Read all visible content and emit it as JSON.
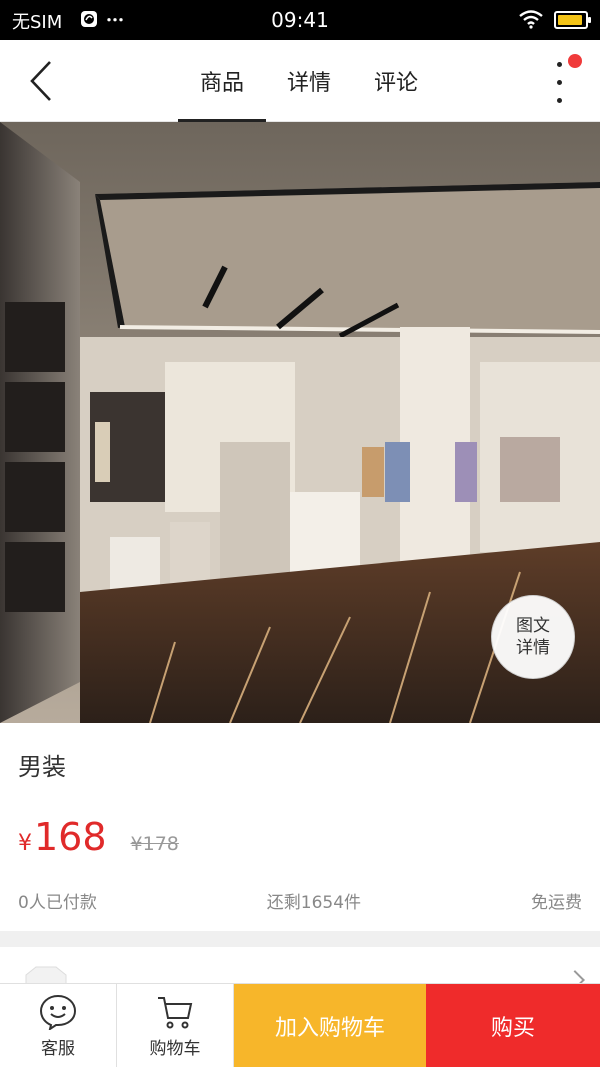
{
  "status_bar": {
    "carrier": "无SIM",
    "time": "09:41"
  },
  "nav": {
    "tabs": [
      {
        "label": "商品",
        "active": true
      },
      {
        "label": "详情",
        "active": false
      },
      {
        "label": "评论",
        "active": false
      }
    ],
    "icons": {
      "back": "chevron-left-icon",
      "more": "more-vertical-icon"
    }
  },
  "hero": {
    "detail_button": {
      "line1": "图文",
      "line2": "详情"
    }
  },
  "product": {
    "title": "男装",
    "currency": "¥",
    "price": "168",
    "original_price": "¥178",
    "paid_count": "0人已付款",
    "stock": "还剩1654件",
    "shipping": "免运费"
  },
  "bottom_bar": {
    "service_label": "客服",
    "cart_label": "购物车",
    "add_to_cart_label": "加入购物车",
    "buy_label": "购买"
  },
  "colors": {
    "price_red": "#e02a2a",
    "add_cart_yellow": "#f7b62a",
    "buy_red": "#ef2b2b",
    "badge_red": "#f03a3a"
  }
}
